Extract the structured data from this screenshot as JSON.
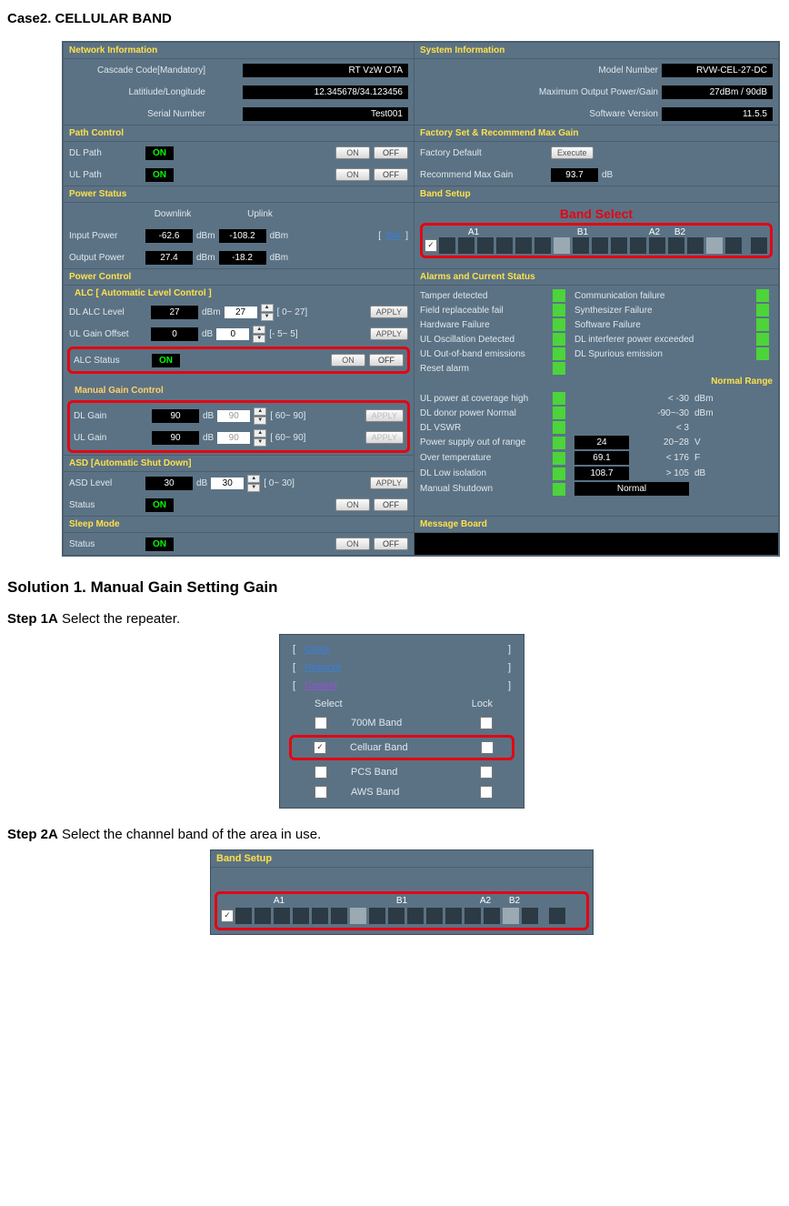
{
  "doc": {
    "case_title": "Case2. CELLULAR BAND",
    "solution_title": "Solution 1. Manual Gain Setting Gain",
    "step1_label": "Step 1A",
    "step1_text": " Select the repeater.",
    "step2_label": "Step 2A",
    "step2_text": " Select the channel band of the area in use."
  },
  "net": {
    "title": "Network Information",
    "cascade_label": "Cascade Code[Mandatory]",
    "cascade_val": "RT VzW OTA",
    "latlon_label": "Latitiude/Longitude",
    "latlon_val": "12.345678/34.123456",
    "serial_label": "Serial Number",
    "serial_val": "Test001"
  },
  "sys": {
    "title": "System Information",
    "model_label": "Model Number",
    "model_val": "RVW-CEL-27-DC",
    "power_label": "Maximum Output Power/Gain",
    "power_val": "27dBm / 90dB",
    "sw_label": "Software Version",
    "sw_val": "11.5.5"
  },
  "path": {
    "title": "Path Control",
    "dl_label": "DL Path",
    "ul_label": "UL Path",
    "on": "ON",
    "btn_on": "ON",
    "btn_off": "OFF"
  },
  "factory": {
    "title": "Factory Set & Recommend Max Gain",
    "default_label": "Factory Default",
    "execute": "Execute",
    "rec_label": "Recommend Max Gain",
    "rec_val": "93.7",
    "db": "dB"
  },
  "pstatus": {
    "title": "Power Status",
    "downlink": "Downlink",
    "uplink": "Uplink",
    "input_label": "Input Power",
    "input_dl": "-62.6",
    "input_ul": "-108.2",
    "output_label": "Output Power",
    "output_dl": "27.4",
    "output_ul": "-18.2",
    "dbm": "dBm",
    "ba_link": "B/A"
  },
  "band": {
    "title": "Band Setup",
    "select_label": "Band Select",
    "a1": "A1",
    "b1": "B1",
    "a2": "A2",
    "b2": "B2"
  },
  "pctrl": {
    "title": "Power Control",
    "alc_title": "ALC [ Automatic Level Control ]",
    "dl_alc_label": "DL ALC Level",
    "dl_alc_val": "27",
    "dl_alc_inp": "27",
    "dl_alc_range": "[ 0~ 27]",
    "ul_off_label": "UL Gain Offset",
    "ul_off_val": "0",
    "ul_off_inp": "0",
    "ul_off_range": "[- 5~  5]",
    "alc_status_label": "ALC Status",
    "mgc_title": "Manual Gain Control",
    "dl_gain_label": "DL Gain",
    "dl_gain_val": "90",
    "dl_gain_inp": "90",
    "dl_gain_range": "[ 60~ 90]",
    "ul_gain_label": "UL Gain",
    "ul_gain_val": "90",
    "ul_gain_inp": "90",
    "ul_gain_range": "[ 60~ 90]",
    "apply": "APPLY",
    "dbm": "dBm",
    "db": "dB",
    "on": "ON",
    "btn_on": "ON",
    "btn_off": "OFF"
  },
  "alarms": {
    "title": "Alarms and Current Status",
    "tamper": "Tamper detected",
    "comm": "Communication failure",
    "field": "Field replaceable fail",
    "synth": "Synthesizer Failure",
    "hw": "Hardware Failure",
    "sw": "Software Failure",
    "ul_osc": "UL Oscillation Detected",
    "dl_intf": "DL interferer power exceeded",
    "ul_oob": "UL Out-of-band emissions",
    "dl_spur": "DL Spurious emission",
    "reset": "Reset alarm",
    "normal_range": "Normal Range",
    "ul_cov": "UL power at coverage high",
    "ul_cov_range": "< -30",
    "ul_cov_unit": "dBm",
    "dl_donor": "DL donor power Normal",
    "dl_donor_range": "-90~-30",
    "dl_donor_unit": "dBm",
    "dl_vswr": "DL VSWR",
    "dl_vswr_range": "< 3",
    "psu": "Power supply out of range",
    "psu_val": "24",
    "psu_range": "20~28",
    "psu_unit": "V",
    "temp": "Over temperature",
    "temp_val": "69.1",
    "temp_range": "< 176",
    "temp_unit": "F",
    "iso": "DL Low isolation",
    "iso_val": "108.7",
    "iso_range": "> 105",
    "iso_unit": "dB",
    "man": "Manual Shutdown",
    "man_val": "Normal"
  },
  "asd": {
    "title": "ASD [Automatic Shut Down]",
    "level_label": "ASD Level",
    "level_val": "30",
    "level_inp": "30",
    "level_range": "[ 0~ 30]",
    "status_label": "Status",
    "apply": "APPLY",
    "db": "dB",
    "on": "ON",
    "btn_on": "ON",
    "btn_off": "OFF"
  },
  "sleep": {
    "title": "Sleep Mode",
    "status_label": "Status",
    "on": "ON",
    "btn_on": "ON",
    "btn_off": "OFF"
  },
  "msg": {
    "title": "Message Board"
  },
  "repeater": {
    "clock": "Clock",
    "network": "Network",
    "control": "Control",
    "select": "Select",
    "lock": "Lock",
    "b700": "700M Band",
    "cell": "Celluar Band",
    "pcs": "PCS Band",
    "aws": "AWS Band"
  }
}
